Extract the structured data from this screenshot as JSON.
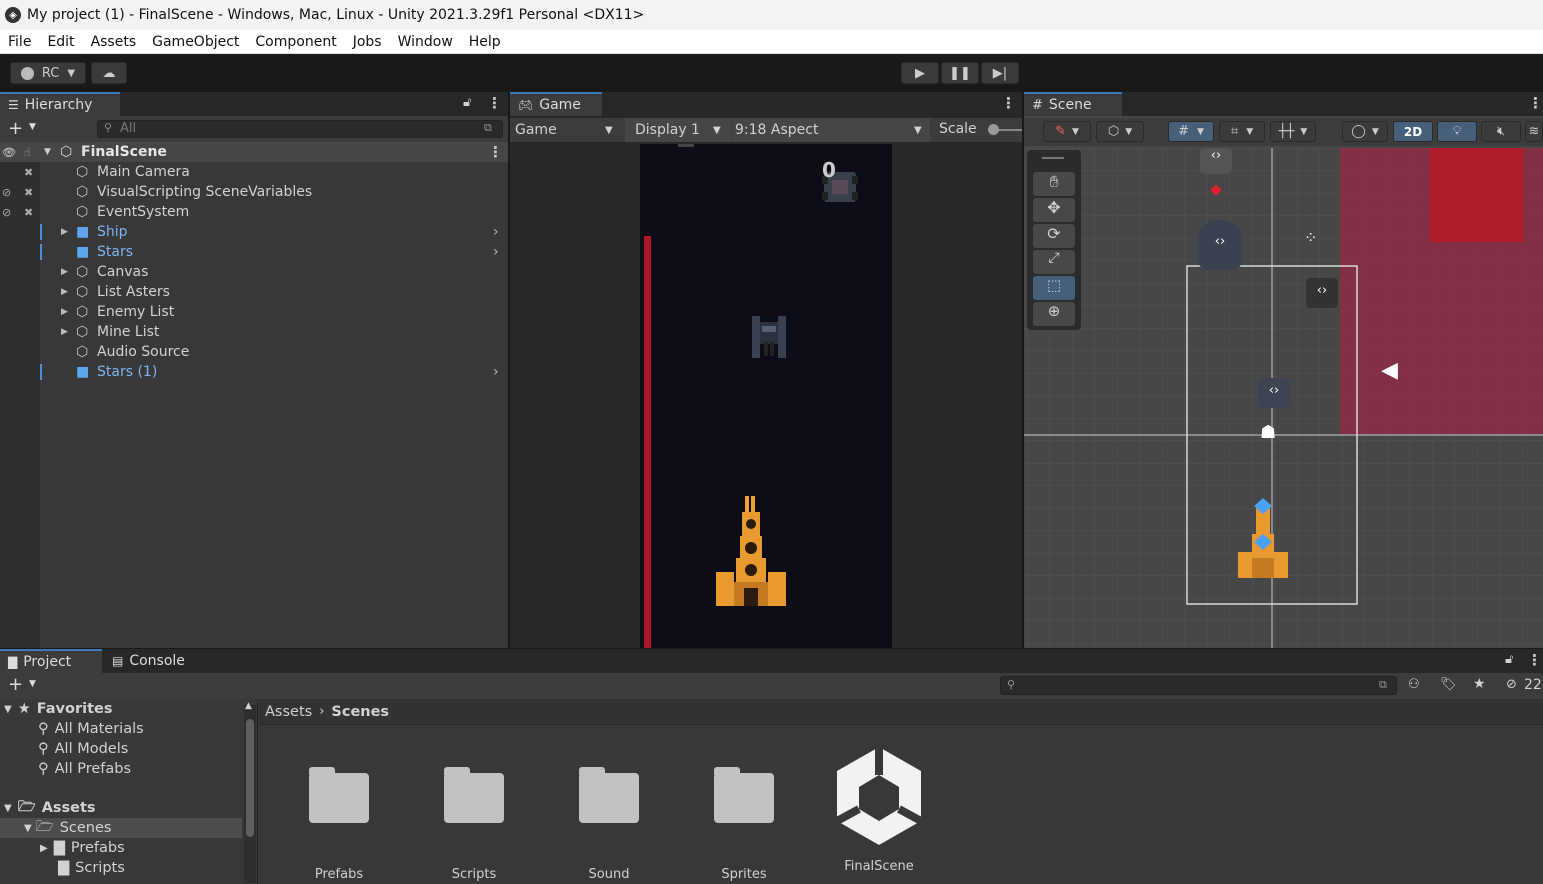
{
  "window": {
    "title": "My project (1) - FinalScene - Windows, Mac, Linux - Unity 2021.3.29f1 Personal <DX11>"
  },
  "menu": [
    "File",
    "Edit",
    "Assets",
    "GameObject",
    "Component",
    "Jobs",
    "Window",
    "Help"
  ],
  "toolbar": {
    "account": "RC"
  },
  "hierarchy": {
    "tab": "Hierarchy",
    "search_placeholder": "All",
    "scene": "FinalScene",
    "items": [
      {
        "label": "Main Camera",
        "prefab": false,
        "expandable": false
      },
      {
        "label": "VisualScripting SceneVariables",
        "prefab": false,
        "expandable": false
      },
      {
        "label": "EventSystem",
        "prefab": false,
        "expandable": false
      },
      {
        "label": "Ship",
        "prefab": true,
        "expandable": true
      },
      {
        "label": "Stars",
        "prefab": true,
        "expandable": false
      },
      {
        "label": "Canvas",
        "prefab": false,
        "expandable": true
      },
      {
        "label": "List Asters",
        "prefab": false,
        "expandable": true
      },
      {
        "label": "Enemy List",
        "prefab": false,
        "expandable": true
      },
      {
        "label": "Mine List",
        "prefab": false,
        "expandable": true
      },
      {
        "label": "Audio Source",
        "prefab": false,
        "expandable": false
      },
      {
        "label": "Stars (1)",
        "prefab": true,
        "expandable": false
      }
    ]
  },
  "game": {
    "tab": "Game",
    "mode": "Game",
    "display": "Display 1",
    "aspect": "9:18 Aspect",
    "scale_label": "Scale",
    "score": "0"
  },
  "scene": {
    "tab": "Scene",
    "mode_2d": "2D"
  },
  "project": {
    "tabs": [
      "Project",
      "Console"
    ],
    "favorites_label": "Favorites",
    "favorites": [
      "All Materials",
      "All Models",
      "All Prefabs"
    ],
    "assets_label": "Assets",
    "tree": [
      "Scenes",
      "Prefabs",
      "Scripts"
    ],
    "breadcrumb": [
      "Assets",
      "Scenes"
    ],
    "hidden_count": "22",
    "grid": [
      "Prefabs",
      "Scripts",
      "Sound",
      "Sprites",
      "FinalScene"
    ]
  },
  "colors": {
    "accent": "#3a79bb",
    "prefab_blue": "#7fb3f5",
    "scene_red": "#a81d3a"
  }
}
